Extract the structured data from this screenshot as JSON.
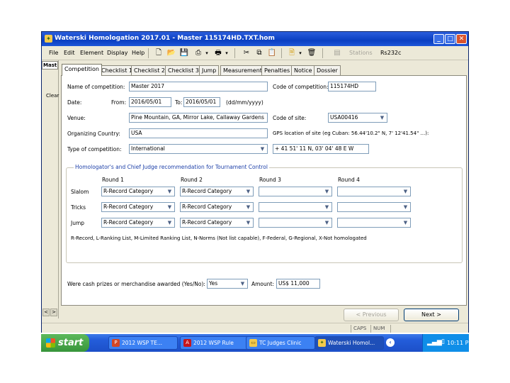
{
  "window": {
    "title": "Waterski Homologation 2017.01 - Master 115174HD.TXT.hom",
    "minimize": "_",
    "maximize": "□",
    "close": "✕"
  },
  "menu": [
    "File",
    "Edit",
    "Element",
    "Display",
    "Help"
  ],
  "toolbar": {
    "stations_label": "Stations",
    "port_label": "Rs232c"
  },
  "leftstrip": {
    "top_label": "Mast",
    "mid_label": "Clear",
    "scroll_left": "<",
    "scroll_right": ">"
  },
  "tabs": [
    "Competition",
    "Checklist 1",
    "Checklist 2",
    "Checklist 3",
    "Jump",
    "Measurements",
    "Penalties",
    "Notice",
    "Dossier"
  ],
  "form": {
    "name_label": "Name of competition:",
    "name_value": "Master 2017",
    "code_label": "Code of competition:",
    "code_value": "115174HD",
    "date_label": "Date:",
    "from_label": "From:",
    "from_value": "2016/05/01",
    "to_label": "To:",
    "to_value": "2016/05/01",
    "date_format": "(dd/mm/yyyy)",
    "venue_label": "Venue:",
    "venue_value": "Pine Mountain, GA, Mirror Lake, Callaway Gardens",
    "site_code_label": "Code of site:",
    "site_code_value": "USA00416",
    "org_label": "Organizing Country:",
    "org_value": "USA",
    "gps_label": "GPS location of site (eg Cuban: 56.44'10.2\" N, 7' 12'41.54\" ...):",
    "type_label": "Type of competition:",
    "type_value": "International",
    "gps_value": "+ 41 51' 11 N, 03' 04' 48 E W",
    "group_title": "Homologator's and Chief Judge recommendation for Tournament Control",
    "round_headers": [
      "Round 1",
      "Round 2",
      "Round 3",
      "Round 4"
    ],
    "events": [
      {
        "label": "Slalom",
        "rounds": [
          "R-Record Category",
          "R-Record Category",
          "",
          ""
        ]
      },
      {
        "label": "Tricks",
        "rounds": [
          "R-Record Category",
          "R-Record Category",
          "",
          ""
        ]
      },
      {
        "label": "Jump",
        "rounds": [
          "R-Record Category",
          "R-Record Category",
          "",
          ""
        ]
      }
    ],
    "legend": "R-Record, L-Ranking List, M-Limited Ranking List, N-Norms (Not list capable), F-Federal, G-Regional, X-Not homologated",
    "prize_label": "Were cash prizes or merchandise awarded (Yes/No):",
    "prize_value": "Yes",
    "amount_label": "Amount:",
    "amount_value": "US$ 11,000"
  },
  "buttons": {
    "previous": "< Previous",
    "next": "Next >"
  },
  "status": {
    "caps": "CAPS",
    "num": "NUM"
  },
  "taskbar": {
    "start": "start",
    "tasks": [
      "2012 WSP TE...",
      "2012 WSP Rule",
      "TC Judges Clinic",
      "Waterski Homol..."
    ],
    "clock": "10:11 PM"
  }
}
